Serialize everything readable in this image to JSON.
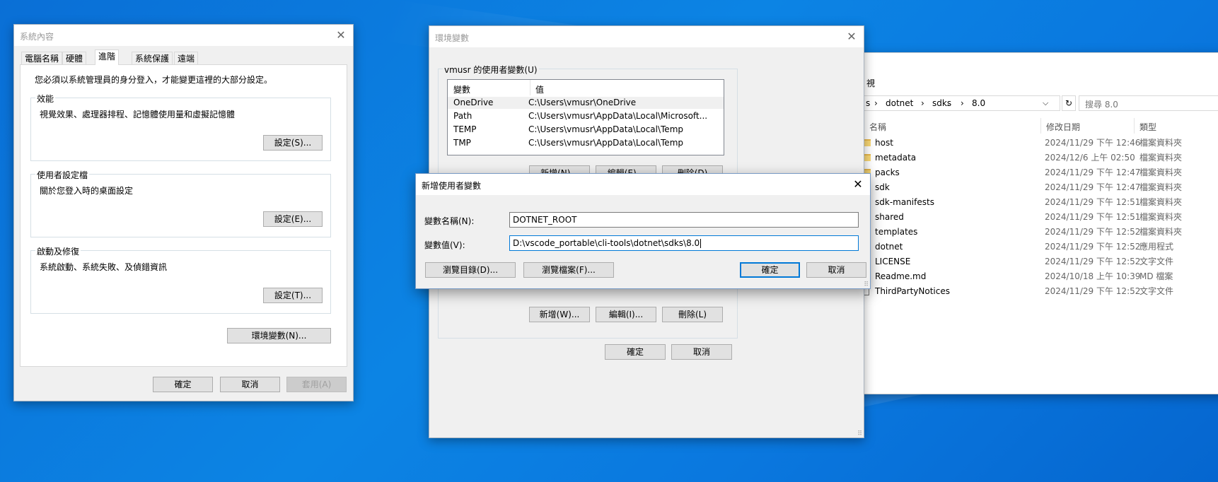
{
  "system_props": {
    "title": "系統內容",
    "tabs": [
      "電腦名稱",
      "硬體",
      "進階",
      "系統保護",
      "遠端"
    ],
    "active_tab": 2,
    "admin_note": "您必須以系統管理員的身分登入，才能變更這裡的大部分設定。",
    "performance": {
      "label": "效能",
      "desc": "視覺效果、處理器排程、記憶體使用量和虛擬記憶體",
      "button": "設定(S)..."
    },
    "user_profile": {
      "label": "使用者設定檔",
      "desc": "關於您登入時的桌面設定",
      "button": "設定(E)..."
    },
    "startup": {
      "label": "啟動及修復",
      "desc": "系統啟動、系統失敗、及偵錯資訊",
      "button": "設定(T)..."
    },
    "env_button": "環境變數(N)...",
    "ok": "確定",
    "cancel": "取消",
    "apply": "套用(A)"
  },
  "env_vars": {
    "title": "環境變數",
    "user_group_label": "vmusr 的使用者變數(U)",
    "columns": [
      "變數",
      "值"
    ],
    "rows": [
      {
        "name": "OneDrive",
        "value": "C:\\Users\\vmusr\\OneDrive"
      },
      {
        "name": "Path",
        "value": "C:\\Users\\vmusr\\AppData\\Local\\Microsoft..."
      },
      {
        "name": "TEMP",
        "value": "C:\\Users\\vmusr\\AppData\\Local\\Temp"
      },
      {
        "name": "TMP",
        "value": "C:\\Users\\vmusr\\AppData\\Local\\Temp"
      }
    ],
    "top_buttons": [
      "新增(N)...",
      "編輯(E)...",
      "刪除(D)"
    ],
    "sys_buttons": [
      "新增(W)...",
      "編輯(I)...",
      "刪除(L)"
    ],
    "ok": "確定",
    "cancel": "取消"
  },
  "new_var": {
    "title": "新增使用者變數",
    "name_label": "變數名稱(N):",
    "name_value": "DOTNET_ROOT",
    "value_label": "變數值(V):",
    "value_value": "D:\\vscode_portable\\cli-tools\\dotnet\\sdks\\8.0",
    "browse_dir": "瀏覽目錄(D)...",
    "browse_file": "瀏覽檔案(F)...",
    "ok": "確定",
    "cancel": "取消"
  },
  "explorer": {
    "menu_partial": "視",
    "path": [
      "s",
      "dotnet",
      "sdks",
      "8.0"
    ],
    "search_placeholder": "搜尋 8.0",
    "columns": {
      "name": "名稱",
      "date": "修改日期",
      "type": "類型"
    },
    "items": [
      {
        "name": "host",
        "date": "2024/11/29 下午 12:46",
        "type": "檔案資料夾",
        "icon": "folder"
      },
      {
        "name": "metadata",
        "date": "2024/12/6 上午 02:50",
        "type": "檔案資料夾",
        "icon": "folder"
      },
      {
        "name": "packs",
        "date": "2024/11/29 下午 12:47",
        "type": "檔案資料夾",
        "icon": "folder"
      },
      {
        "name": "sdk",
        "date": "2024/11/29 下午 12:47",
        "type": "檔案資料夾",
        "icon": "folder"
      },
      {
        "name": "sdk-manifests",
        "date": "2024/11/29 下午 12:51",
        "type": "檔案資料夾",
        "icon": "folder"
      },
      {
        "name": "shared",
        "date": "2024/11/29 下午 12:51",
        "type": "檔案資料夾",
        "icon": "folder"
      },
      {
        "name": "templates",
        "date": "2024/11/29 下午 12:52",
        "type": "檔案資料夾",
        "icon": "folder"
      },
      {
        "name": "dotnet",
        "date": "2024/11/29 下午 12:52",
        "type": "應用程式",
        "icon": "exe"
      },
      {
        "name": "LICENSE",
        "date": "2024/11/29 下午 12:52",
        "type": "文字文件",
        "icon": "file"
      },
      {
        "name": "Readme.md",
        "date": "2024/10/18 上午 10:39",
        "type": "MD 檔案",
        "icon": "file"
      },
      {
        "name": "ThirdPartyNotices",
        "date": "2024/11/29 下午 12:52",
        "type": "文字文件",
        "icon": "file"
      }
    ]
  }
}
